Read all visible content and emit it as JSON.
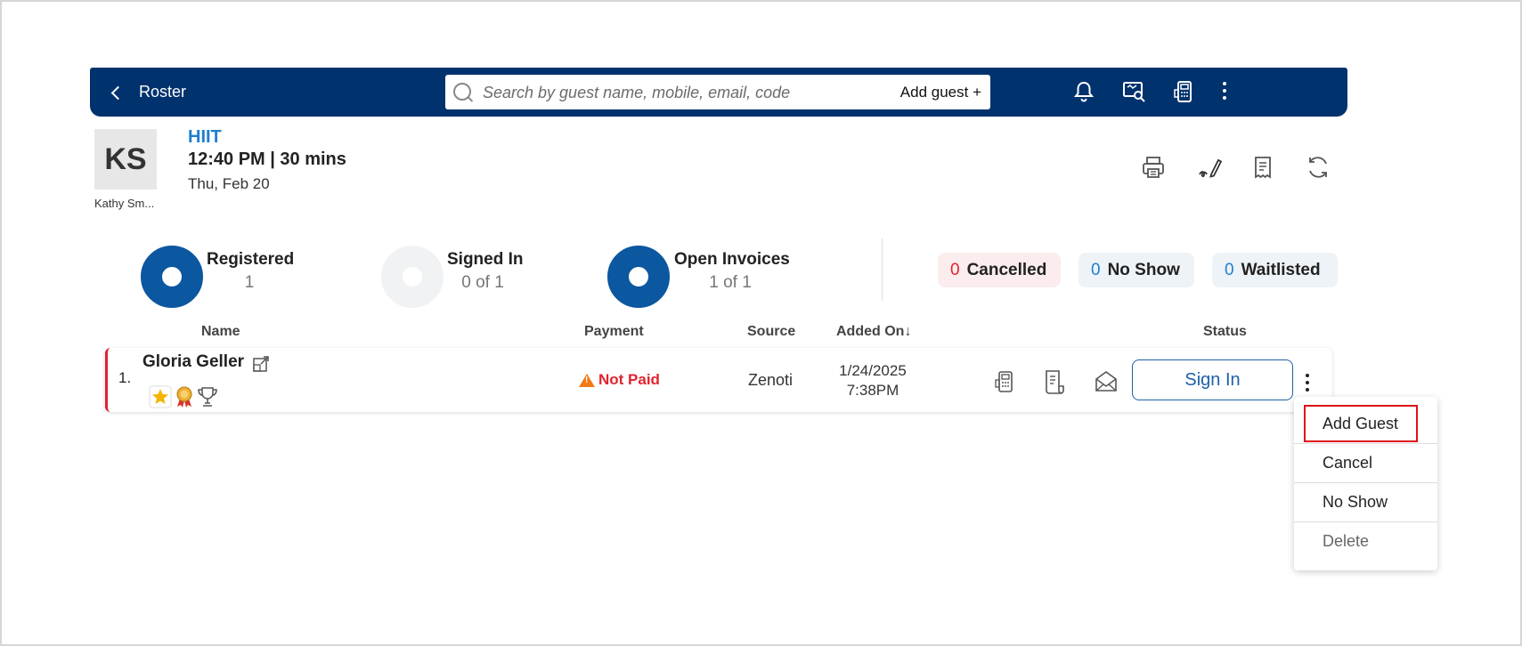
{
  "topbar": {
    "back_label": "Roster",
    "search_placeholder": "Search by guest name, mobile, email, code",
    "add_guest_label": "Add guest +",
    "icons": [
      "bell-icon",
      "screen-search-icon",
      "card-terminal-icon",
      "more-vertical-icon"
    ]
  },
  "class_info": {
    "avatar_initials": "KS",
    "instructor_name": "Kathy Sm...",
    "name": "HIIT",
    "time": "12:40 PM | 30 mins",
    "date": "Thu, Feb 20",
    "icons": [
      "print-icon",
      "signature-icon",
      "receipt-icon",
      "refresh-icon"
    ]
  },
  "stats": {
    "registered": {
      "label": "Registered",
      "value": "1"
    },
    "signed_in": {
      "label": "Signed In",
      "value": "0 of 1"
    },
    "open_invoices": {
      "label": "Open Invoices",
      "value": "1 of 1"
    },
    "cancelled": {
      "count": "0",
      "label": "Cancelled"
    },
    "no_show": {
      "count": "0",
      "label": "No Show"
    },
    "waitlisted": {
      "count": "0",
      "label": "Waitlisted"
    }
  },
  "table": {
    "headers": {
      "name": "Name",
      "payment": "Payment",
      "source": "Source",
      "added_on": "Added On",
      "sort_arrow": "↓",
      "status": "Status"
    },
    "rows": [
      {
        "index": "1.",
        "name": "Gloria Geller",
        "badges": [
          "star-badge-icon",
          "award-ribbon-icon",
          "trophy-icon"
        ],
        "payment": "Not Paid",
        "source": "Zenoti",
        "added_date": "1/24/2025",
        "added_time": "7:38PM",
        "actions": [
          "card-terminal-icon",
          "invoice-icon",
          "email-icon"
        ],
        "sign_in_label": "Sign In"
      }
    ]
  },
  "dropdown": {
    "items": [
      "Add Guest",
      "Cancel",
      "No Show",
      "Delete"
    ],
    "highlighted": "Add Guest"
  },
  "colors": {
    "topbar": "#00326e",
    "accent_blue": "#1e7fd0",
    "donut_blue": "#0b57a0",
    "alert_red": "#e0242f",
    "warning_orange": "#f07a15",
    "cancelled_bg": "#fbeded",
    "status_bg": "#eef3f8"
  }
}
